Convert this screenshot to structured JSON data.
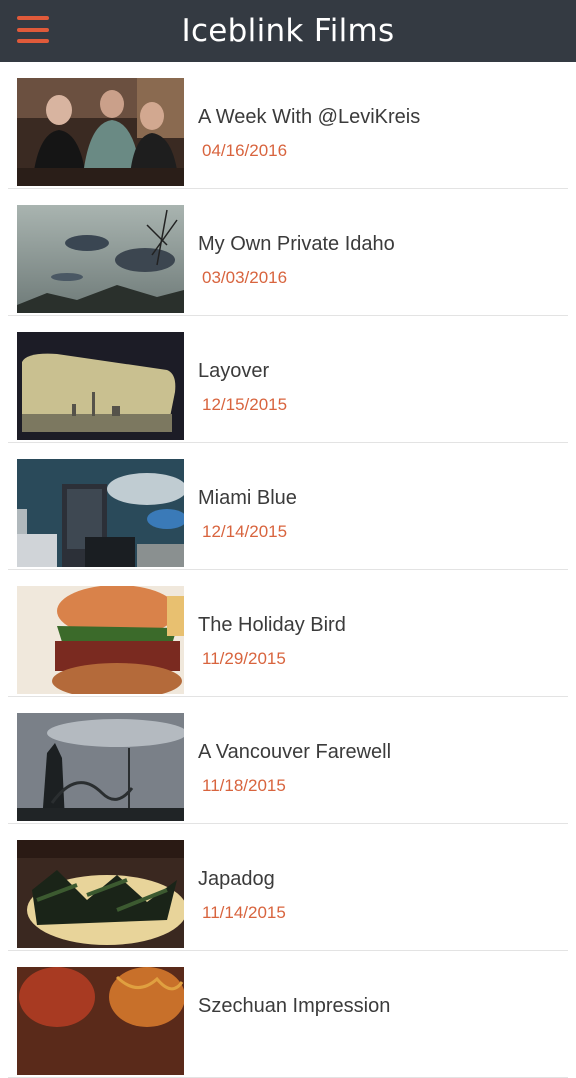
{
  "header": {
    "title": "Iceblink Films",
    "menu_icon": "hamburger-menu-icon"
  },
  "colors": {
    "header_bg": "#343a42",
    "accent": "#e05a3a",
    "date": "#d8643e",
    "title_text": "#3b3b3b"
  },
  "films": [
    {
      "title": "A Week With @LeviKreis",
      "date": "04/16/2016",
      "thumb_icon": "three-men-photo"
    },
    {
      "title": "My Own Private Idaho",
      "date": "03/03/2016",
      "thumb_icon": "cloudy-sky-photo"
    },
    {
      "title": "Layover",
      "date": "12/15/2015",
      "thumb_icon": "airplane-window-city-photo"
    },
    {
      "title": "Miami Blue",
      "date": "12/14/2015",
      "thumb_icon": "hotel-tower-photo"
    },
    {
      "title": "The Holiday Bird",
      "date": "11/29/2015",
      "thumb_icon": "burger-photo"
    },
    {
      "title": "A Vancouver Farewell",
      "date": "11/18/2015",
      "thumb_icon": "roller-coaster-photo"
    },
    {
      "title": "Japadog",
      "date": "11/14/2015",
      "thumb_icon": "hot-dog-photo"
    },
    {
      "title": "Szechuan Impression",
      "date": "",
      "thumb_icon": "noodles-photo"
    }
  ]
}
